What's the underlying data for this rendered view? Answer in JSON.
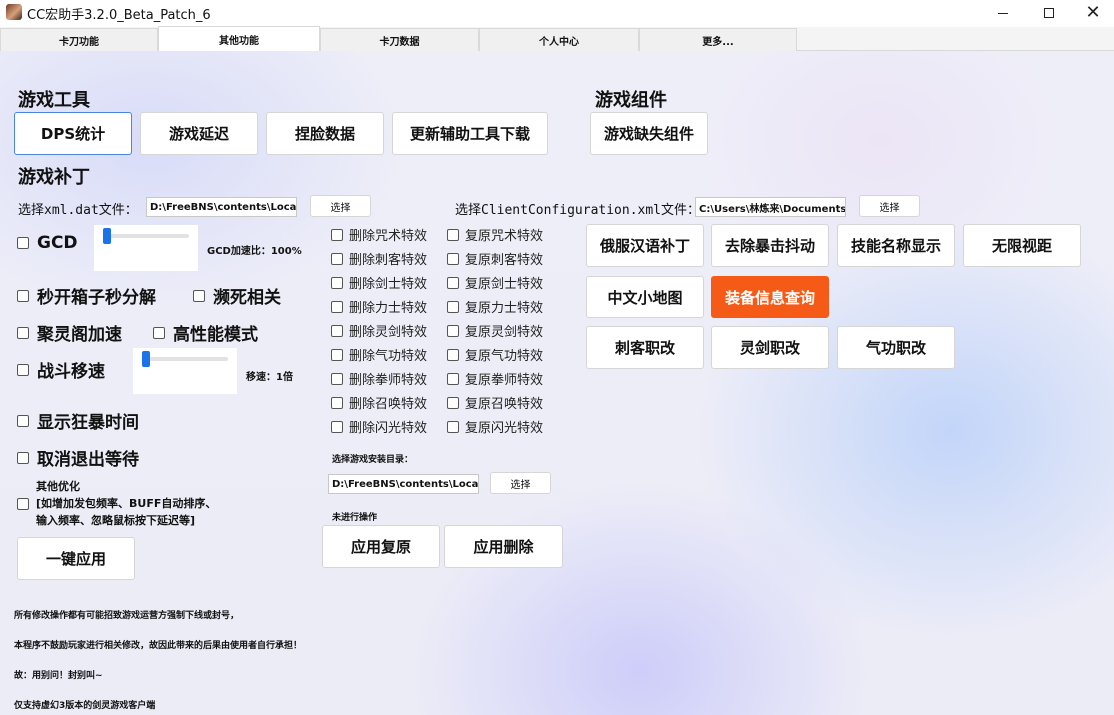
{
  "window": {
    "title": "CC宏助手3.2.0_Beta_Patch_6"
  },
  "tabs": [
    "卡刀功能",
    "其他功能",
    "卡刀数据",
    "个人中心",
    "更多..."
  ],
  "left": {
    "tools_heading": "游戏工具",
    "tool_buttons": [
      "DPS统计",
      "游戏延迟",
      "捏脸数据",
      "更新辅助工具下载"
    ],
    "patch_heading": "游戏补丁",
    "xml_label": "选择xml.dat文件：",
    "xml_path": "D:\\FreeBNS\\contents\\Local\\NCWEST\\data\\xml.dat",
    "select_label": "选择",
    "gcd_label": "GCD",
    "gcd_ratio": "GCD加速比：100%",
    "gcd_level": 0.05,
    "chk_box_open": "秒开箱子秒分解",
    "chk_dying": "濒死相关",
    "chk_juling": "聚灵阁加速",
    "chk_perf": "高性能模式",
    "chk_move": "战斗移速",
    "move_speed": "移速：1倍",
    "move_level": 0.05,
    "chk_rage": "显示狂暴时间",
    "chk_cancel_wait": "取消退出等待",
    "other_title": "其他优化",
    "other_line1": "[如增加发包频率、BUFF自动排序、",
    "other_line2": "输入频率、忽略鼠标按下延迟等]",
    "apply_all": "一键应用"
  },
  "effects": {
    "delete": [
      "删除咒术特效",
      "删除刺客特效",
      "删除剑士特效",
      "删除力士特效",
      "删除灵剑特效",
      "删除气功特效",
      "删除拳师特效",
      "删除召唤特效",
      "删除闪光特效"
    ],
    "restore": [
      "复原咒术特效",
      "复原刺客特效",
      "复原剑士特效",
      "复原力士特效",
      "复原灵剑特效",
      "复原气功特效",
      "复原拳师特效",
      "复原召唤特效",
      "复原闪光特效"
    ],
    "install_dir_label": "选择游戏安装目录：",
    "install_path": "D:\\FreeBNS\\contents\\Local\\NCWEST",
    "select_label": "选择",
    "status": "未进行操作",
    "apply_restore": "应用复原",
    "apply_delete": "应用删除"
  },
  "right": {
    "components_heading": "游戏组件",
    "missing_components": "游戏缺失组件",
    "client_label": "选择ClientConfiguration.xml文件：",
    "client_path": "C:\\Users\\林炼来\\Documents\\BnS\\NCWEST\\ClientConfiguration.xml",
    "select_label": "选择",
    "buttons_row1": [
      "俄服汉语补丁",
      "去除暴击抖动",
      "技能名称显示",
      "无限视距"
    ],
    "buttons_row2": [
      "中文小地图",
      "装备信息查询"
    ],
    "buttons_row3": [
      "刺客职改",
      "灵剑职改",
      "气功职改"
    ],
    "accent_color": "#f55a16"
  },
  "notes": [
    "所有修改操作都有可能招致游戏运营方强制下线或封号，",
    "本程序不鼓励玩家进行相关修改，故因此带来的后果由使用者自行承担！",
    "故：用别问！封别叫~",
    "仅支持虚幻3版本的剑灵游戏客户端"
  ]
}
